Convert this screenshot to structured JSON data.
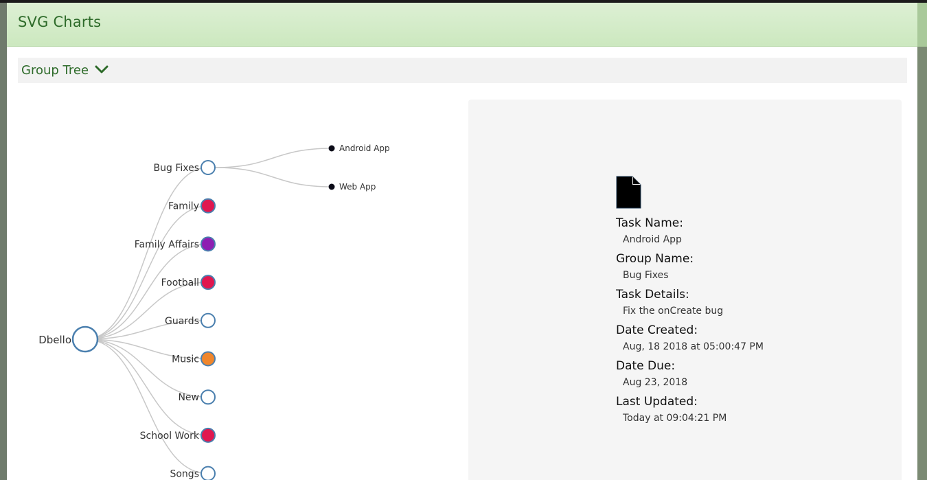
{
  "modal": {
    "title": "SVG Charts"
  },
  "section": {
    "label": "Group Tree"
  },
  "tree": {
    "root": {
      "name": "Dbello",
      "fill": "#ffffff"
    },
    "groups": [
      {
        "name": "Bug Fixes",
        "fill": "#ffffff",
        "children": [
          {
            "name": "Android App"
          },
          {
            "name": "Web App"
          }
        ]
      },
      {
        "name": "Family",
        "fill": "#e0174f"
      },
      {
        "name": "Family Affairs",
        "fill": "#8e1fb2"
      },
      {
        "name": "Football",
        "fill": "#e0174f"
      },
      {
        "name": "Guards",
        "fill": "#ffffff"
      },
      {
        "name": "Music",
        "fill": "#f0862c"
      },
      {
        "name": "New",
        "fill": "#ffffff"
      },
      {
        "name": "School Work",
        "fill": "#e0174f"
      },
      {
        "name": "Songs",
        "fill": "#ffffff"
      }
    ],
    "node_stroke": "#4a7fae",
    "leaf_fill": "#0b0b18"
  },
  "details": {
    "task_name_label": "Task Name:",
    "task_name": "Android App",
    "group_name_label": "Group Name:",
    "group_name": "Bug Fixes",
    "task_details_label": "Task Details:",
    "task_details": "Fix the onCreate bug",
    "date_created_label": "Date Created:",
    "date_created": "Aug, 18 2018 at 05:00:47 PM",
    "date_due_label": "Date Due:",
    "date_due": "Aug 23, 2018",
    "last_updated_label": "Last Updated:",
    "last_updated": "Today at 09:04:21 PM"
  },
  "icons": {
    "section_toggle": "chevron-down-icon",
    "document": "document-icon"
  },
  "colors": {
    "header_green": "#2e6b2a"
  }
}
